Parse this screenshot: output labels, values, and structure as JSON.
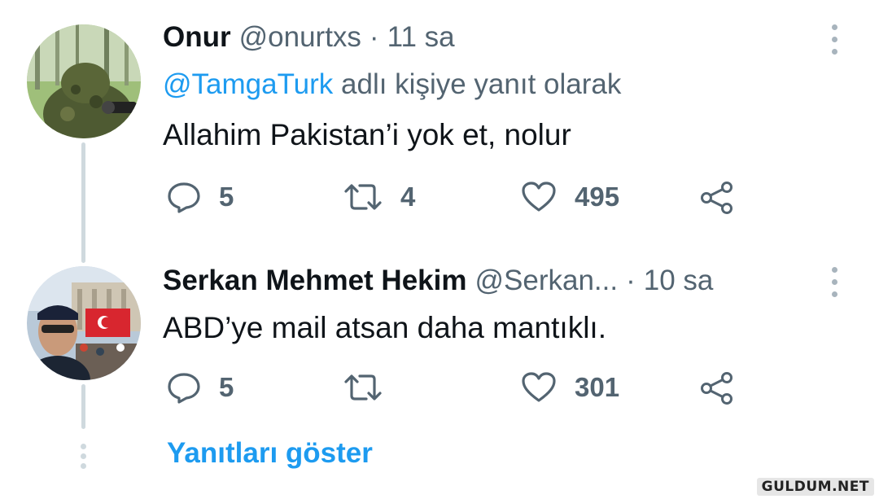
{
  "tweets": [
    {
      "name": "Onur",
      "handle": "@onurtxs",
      "sep": "·",
      "time": "11 sa",
      "reply_to_mention": "@TamgaTurk",
      "reply_to_suffix": "adlı kişiye yanıt olarak",
      "text": "Allahim Pakistan’i yok et, nolur",
      "replies": "5",
      "retweets": "4",
      "likes": "495"
    },
    {
      "name": "Serkan Mehmet Hekim",
      "handle": "@Serkan...",
      "sep": "·",
      "time": "10 sa",
      "text": "ABD’ye mail atsan daha mantıklı.",
      "replies": "5",
      "retweets": "",
      "likes": "301"
    }
  ],
  "show_replies_label": "Yanıtları göster",
  "watermark": "GULDUM.NET",
  "colors": {
    "accent": "#1d9bf0",
    "muted": "#536471",
    "thread_line": "#cfd9de"
  },
  "icons": [
    "reply-icon",
    "retweet-icon",
    "like-icon",
    "share-icon",
    "more-icon"
  ]
}
